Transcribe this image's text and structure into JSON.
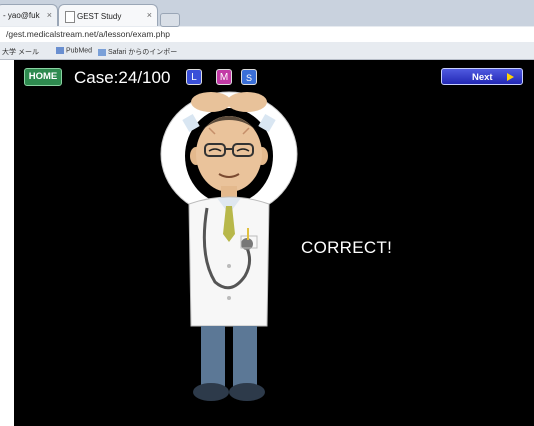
{
  "browser": {
    "tabs": [
      {
        "label": "- yao@fuk",
        "active": false
      },
      {
        "label": "GEST Study",
        "active": true
      }
    ],
    "url": "/gest.medicalstream.net/a/lesson/exam.php",
    "bookmarks": [
      "大学 メール",
      "PubMed",
      "Safari からのインポー"
    ]
  },
  "game": {
    "home_label": "HOME",
    "case_label": "Case:24/100",
    "levels": [
      {
        "label": "L",
        "color": "#3a4fd8"
      },
      {
        "label": "M",
        "color": "#c23aa6"
      },
      {
        "label": "S",
        "color": "#3a6fd8"
      }
    ],
    "next_label": "Next",
    "result_text": "CORRECT!"
  },
  "colors": {
    "background": "#000000",
    "home": "#2e8a4f",
    "next": "#3a43cc",
    "arrow": "#ffd400"
  }
}
